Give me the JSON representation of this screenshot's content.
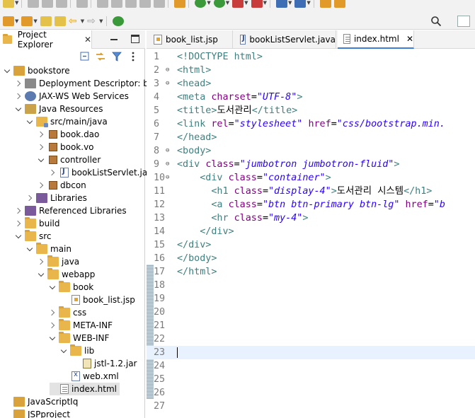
{
  "explorer": {
    "tab_label": "Project Explorer",
    "close_glyph": "✕",
    "tree": [
      {
        "label": "bookstore",
        "icon": "project-icon",
        "depth": 0,
        "state": "open"
      },
      {
        "label": "Deployment Descriptor: bo",
        "icon": "deployment-descriptor-icon",
        "depth": 1,
        "state": "closed"
      },
      {
        "label": "JAX-WS Web Services",
        "icon": "web-services-icon",
        "depth": 1,
        "state": "closed"
      },
      {
        "label": "Java Resources",
        "icon": "java-resources-icon",
        "depth": 1,
        "state": "open"
      },
      {
        "label": "src/main/java",
        "icon": "source-folder-icon",
        "depth": 2,
        "state": "open"
      },
      {
        "label": "book.dao",
        "icon": "package-icon",
        "depth": 3,
        "state": "closed"
      },
      {
        "label": "book.vo",
        "icon": "package-icon",
        "depth": 3,
        "state": "closed"
      },
      {
        "label": "controller",
        "icon": "package-icon",
        "depth": 3,
        "state": "open"
      },
      {
        "label": "bookListServlet.jav",
        "icon": "java-file-icon",
        "depth": 4,
        "state": "closed"
      },
      {
        "label": "dbcon",
        "icon": "package-icon",
        "depth": 3,
        "state": "closed"
      },
      {
        "label": "Libraries",
        "icon": "libraries-icon",
        "depth": 2,
        "state": "closed"
      },
      {
        "label": "Referenced Libraries",
        "icon": "libraries-icon",
        "depth": 1,
        "state": "closed"
      },
      {
        "label": "build",
        "icon": "folder-icon",
        "depth": 1,
        "state": "closed"
      },
      {
        "label": "src",
        "icon": "folder-icon",
        "depth": 1,
        "state": "open"
      },
      {
        "label": "main",
        "icon": "folder-icon",
        "depth": 2,
        "state": "open"
      },
      {
        "label": "java",
        "icon": "folder-icon",
        "depth": 3,
        "state": "closed"
      },
      {
        "label": "webapp",
        "icon": "folder-icon",
        "depth": 3,
        "state": "open"
      },
      {
        "label": "book",
        "icon": "folder-icon",
        "depth": 4,
        "state": "open"
      },
      {
        "label": "book_list.jsp",
        "icon": "jsp-file-icon",
        "depth": 5,
        "state": "none"
      },
      {
        "label": "css",
        "icon": "folder-icon",
        "depth": 4,
        "state": "closed"
      },
      {
        "label": "META-INF",
        "icon": "folder-icon",
        "depth": 4,
        "state": "closed"
      },
      {
        "label": "WEB-INF",
        "icon": "folder-icon",
        "depth": 4,
        "state": "open"
      },
      {
        "label": "lib",
        "icon": "folder-icon",
        "depth": 5,
        "state": "open"
      },
      {
        "label": "jstl-1.2.jar",
        "icon": "jar-file-icon",
        "depth": 6,
        "state": "none"
      },
      {
        "label": "web.xml",
        "icon": "xml-file-icon",
        "depth": 5,
        "state": "none"
      },
      {
        "label": "index.html",
        "icon": "html-file-icon",
        "depth": 4,
        "state": "none",
        "selected": true
      },
      {
        "label": "JavaScriptIq",
        "icon": "project-icon",
        "depth": 0,
        "state": "none"
      },
      {
        "label": "JSPproject",
        "icon": "project-icon",
        "depth": 0,
        "state": "none"
      }
    ]
  },
  "editor": {
    "tabs": [
      {
        "label": "book_list.jsp",
        "icon": "jsp-file-icon",
        "active": false
      },
      {
        "label": "bookListServlet.java",
        "icon": "java-file-icon",
        "active": false
      },
      {
        "label": "index.html",
        "icon": "html-file-icon",
        "active": true,
        "close": "✕"
      }
    ],
    "current_line": 23,
    "lines": [
      {
        "n": "1",
        "fold": "",
        "tokens": [
          [
            "doc",
            "<!DOCTYPE "
          ],
          [
            "tag",
            "html"
          ],
          [
            "doc",
            ">"
          ]
        ]
      },
      {
        "n": "2",
        "fold": "⊖",
        "tokens": [
          [
            "tag",
            "<html>"
          ]
        ]
      },
      {
        "n": "3",
        "fold": "⊖",
        "tokens": [
          [
            "tag",
            "<head>"
          ]
        ]
      },
      {
        "n": "4",
        "fold": "",
        "tokens": [
          [
            "tag",
            "<meta "
          ],
          [
            "attr",
            "charset"
          ],
          [
            "text",
            "="
          ],
          [
            "val",
            "\"UTF-8\""
          ],
          [
            "tag",
            ">"
          ]
        ]
      },
      {
        "n": "5",
        "fold": "",
        "tokens": [
          [
            "tag",
            "<title>"
          ],
          [
            "text",
            "도서관리"
          ],
          [
            "tag",
            "</title>"
          ]
        ]
      },
      {
        "n": "6",
        "fold": "",
        "tokens": [
          [
            "tag",
            "<link "
          ],
          [
            "attr",
            "rel"
          ],
          [
            "text",
            "="
          ],
          [
            "val",
            "\"stylesheet\""
          ],
          [
            "text",
            " "
          ],
          [
            "attr",
            "href"
          ],
          [
            "text",
            "="
          ],
          [
            "val",
            "\"css/bootstrap.min."
          ]
        ]
      },
      {
        "n": "7",
        "fold": "",
        "tokens": [
          [
            "tag",
            "</head>"
          ]
        ]
      },
      {
        "n": "8",
        "fold": "⊖",
        "tokens": [
          [
            "tag",
            "<body>"
          ]
        ]
      },
      {
        "n": "9",
        "fold": "⊖",
        "tokens": [
          [
            "tag",
            "<div "
          ],
          [
            "attr",
            "class"
          ],
          [
            "text",
            "="
          ],
          [
            "val",
            "\"jumbotron jumbotron-fluid\""
          ],
          [
            "tag",
            ">"
          ]
        ]
      },
      {
        "n": "10",
        "fold": "⊖",
        "tokens": [
          [
            "text",
            "    "
          ],
          [
            "tag",
            "<div "
          ],
          [
            "attr",
            "class"
          ],
          [
            "text",
            "="
          ],
          [
            "val",
            "\"container\""
          ],
          [
            "tag",
            ">"
          ]
        ]
      },
      {
        "n": "11",
        "fold": "",
        "tokens": [
          [
            "text",
            "      "
          ],
          [
            "tag",
            "<h1 "
          ],
          [
            "attr",
            "class"
          ],
          [
            "text",
            "="
          ],
          [
            "val",
            "\"display-4\""
          ],
          [
            "tag",
            ">"
          ],
          [
            "text",
            "도서관리 시스템"
          ],
          [
            "tag",
            "</h1>"
          ]
        ]
      },
      {
        "n": "12",
        "fold": "",
        "tokens": [
          [
            "text",
            "      "
          ],
          [
            "tag",
            "<a "
          ],
          [
            "attr",
            "class"
          ],
          [
            "text",
            "="
          ],
          [
            "val",
            "\"btn btn-primary btn-lg\""
          ],
          [
            "text",
            " "
          ],
          [
            "attr",
            "href"
          ],
          [
            "text",
            "="
          ],
          [
            "val",
            "\"b"
          ]
        ]
      },
      {
        "n": "13",
        "fold": "",
        "tokens": [
          [
            "text",
            "      "
          ],
          [
            "tag",
            "<hr "
          ],
          [
            "attr",
            "class"
          ],
          [
            "text",
            "="
          ],
          [
            "val",
            "\"my-4\""
          ],
          [
            "tag",
            ">"
          ]
        ]
      },
      {
        "n": "14",
        "fold": "",
        "tokens": [
          [
            "text",
            "    "
          ],
          [
            "tag",
            "</div>"
          ]
        ]
      },
      {
        "n": "15",
        "fold": "",
        "tokens": [
          [
            "tag",
            "</div>"
          ]
        ]
      },
      {
        "n": "16",
        "fold": "",
        "tokens": [
          [
            "tag",
            "</body>"
          ]
        ]
      },
      {
        "n": "17",
        "fold": "",
        "tokens": [
          [
            "tag",
            "</html>"
          ]
        ]
      },
      {
        "n": "18",
        "fold": "",
        "tokens": []
      },
      {
        "n": "19",
        "fold": "",
        "tokens": []
      },
      {
        "n": "20",
        "fold": "",
        "tokens": []
      },
      {
        "n": "21",
        "fold": "",
        "tokens": []
      },
      {
        "n": "22",
        "fold": "",
        "tokens": []
      },
      {
        "n": "23",
        "fold": "",
        "tokens": []
      },
      {
        "n": "24",
        "fold": "",
        "tokens": []
      },
      {
        "n": "25",
        "fold": "",
        "tokens": []
      },
      {
        "n": "26",
        "fold": "",
        "tokens": []
      },
      {
        "n": "27",
        "fold": "",
        "tokens": []
      }
    ]
  },
  "colors": {
    "tag": "#3f7f7f",
    "attr": "#7f007f",
    "value": "#2a00ff",
    "current_line_bg": "#e8f2fe",
    "active_tab_accent": "#3f7dd9"
  }
}
